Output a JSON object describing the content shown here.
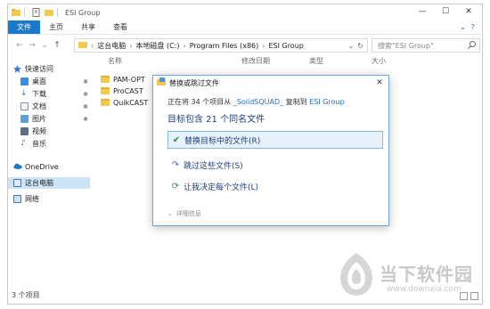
{
  "window": {
    "title": "ESI Group",
    "controls": [
      "—",
      "☐",
      "✕"
    ]
  },
  "ribbon": {
    "tabs": [
      "文件",
      "主页",
      "共享",
      "查看"
    ]
  },
  "address": {
    "crumbs": [
      "这台电脑",
      "本地磁盘 (C:)",
      "Program Files (x86)",
      "ESI Group"
    ],
    "search_placeholder": "搜索\"ESI Group\""
  },
  "nav": {
    "items": [
      {
        "label": "快速访问",
        "icon": "star-icon"
      },
      {
        "label": "桌面",
        "icon": "desktop-icon",
        "pinned": true
      },
      {
        "label": "下载",
        "icon": "download-icon",
        "pinned": true
      },
      {
        "label": "文档",
        "icon": "document-icon",
        "pinned": true
      },
      {
        "label": "图片",
        "icon": "picture-icon",
        "pinned": true
      },
      {
        "label": "视频",
        "icon": "video-icon"
      },
      {
        "label": "音乐",
        "icon": "music-icon"
      },
      {
        "label": "OneDrive",
        "icon": "cloud-icon"
      },
      {
        "label": "这台电脑",
        "icon": "computer-icon",
        "selected": true
      },
      {
        "label": "网络",
        "icon": "network-icon"
      }
    ]
  },
  "filelist": {
    "columns": [
      "名称",
      "修改日期",
      "类型",
      "大小"
    ],
    "files": [
      "PAM-OPT",
      "ProCAST",
      "QuikCAST"
    ]
  },
  "status": {
    "count": "3 个项目"
  },
  "dialog": {
    "title": "替换或跳过文件",
    "info_prefix": "正在将 34 个项目从",
    "info_source": "_SolidSQUAD_",
    "info_mid": "复制到",
    "info_dest": "ESI Group",
    "heading": "目标包含 21 个同名文件",
    "options": [
      {
        "label": "替换目标中的文件(R)",
        "icon": "check-icon"
      },
      {
        "label": "跳过这些文件(S)",
        "icon": "skip-icon"
      },
      {
        "label": "让我决定每个文件(L)",
        "icon": "decide-icon"
      }
    ],
    "details": "详细信息"
  },
  "watermark": {
    "name": "当下软件园",
    "url": "www.downxia.com"
  }
}
